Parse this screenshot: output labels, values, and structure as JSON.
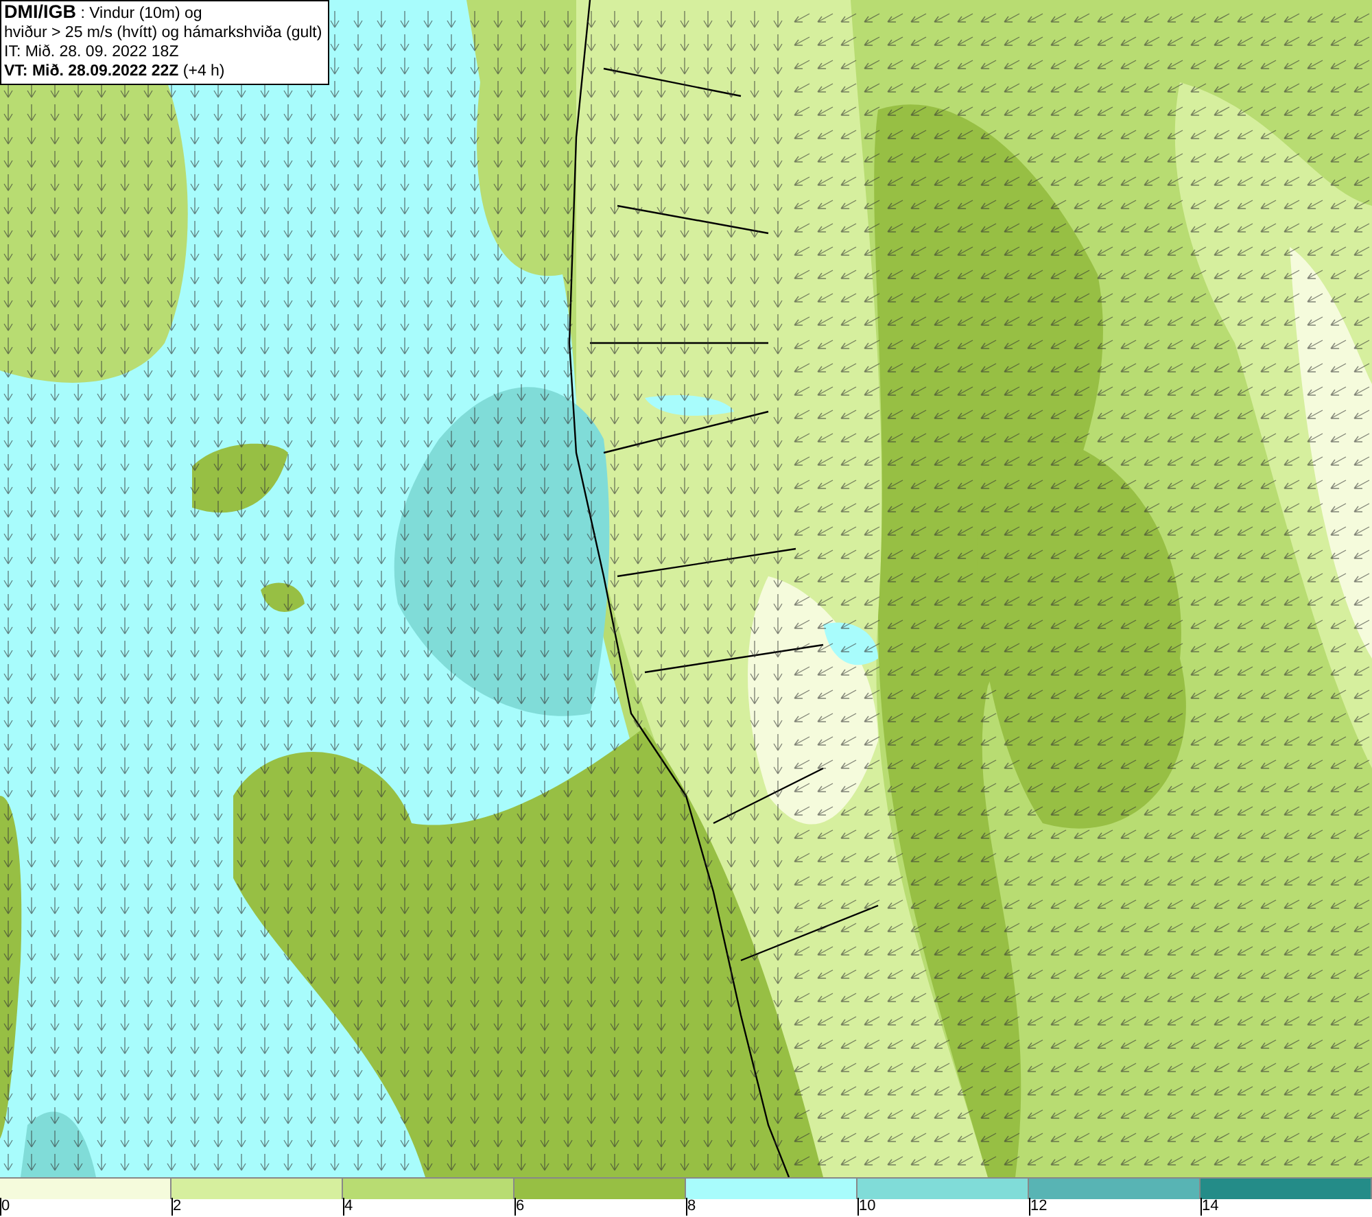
{
  "info_box": {
    "lines": [
      "**DMI/IGB** : Vindur (10m) og",
      "hviður > 25 m/s (hvítt) og hámarkshviða (gult)",
      "IT: Mið. 28. 09. 2022 18Z",
      "**VT: Mið. 28.09.2022 22Z** (+4 h)"
    ]
  },
  "legend": {
    "bins": [
      {
        "label": "0",
        "color": "#f5fbdc"
      },
      {
        "label": "2",
        "color": "#d6ef9e"
      },
      {
        "label": "4",
        "color": "#b8dc72"
      },
      {
        "label": "6",
        "color": "#97bf44"
      },
      {
        "label": "8",
        "color": "#a8fcfc"
      },
      {
        "label": "10",
        "color": "#80dcd8"
      },
      {
        "label": "12",
        "color": "#58b4b4"
      },
      {
        "label": "14",
        "color": "#248c88"
      }
    ]
  }
}
